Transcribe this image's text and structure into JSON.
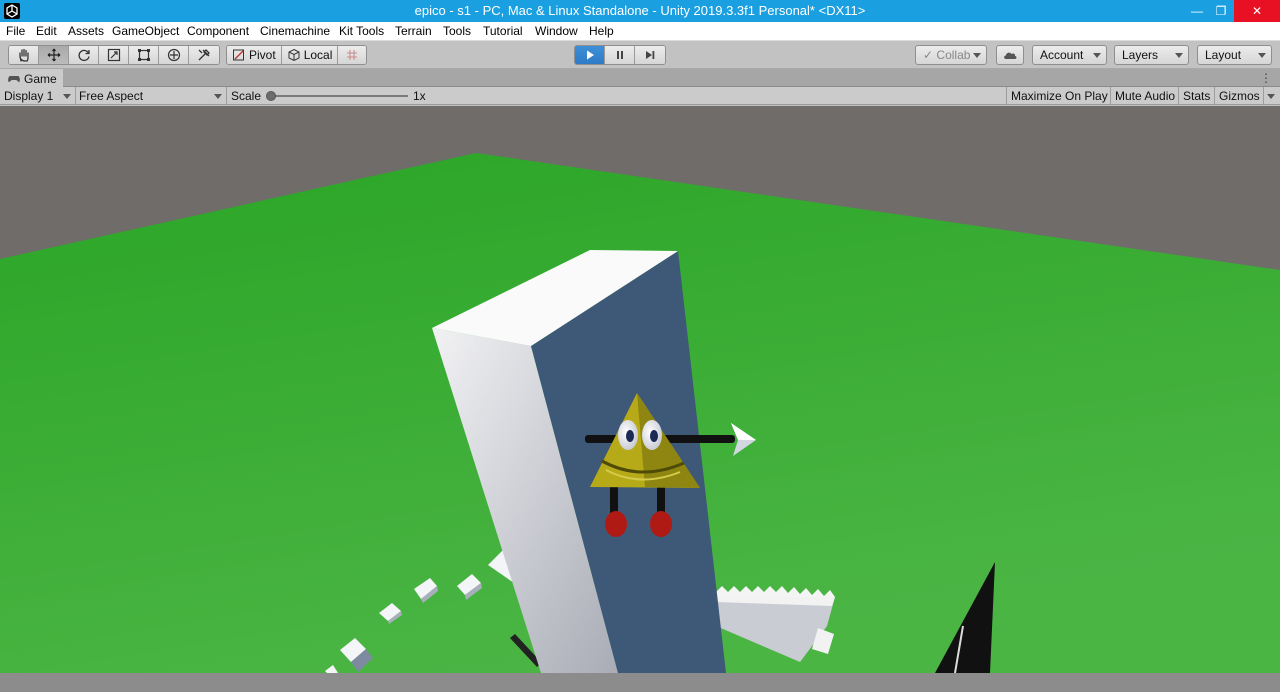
{
  "window": {
    "title": "epico - s1 - PC, Mac & Linux Standalone - Unity 2019.3.3f1 Personal* <DX11>"
  },
  "menu": [
    "File",
    "Edit",
    "Assets",
    "GameObject",
    "Component",
    "Cinemachine",
    "Kit Tools",
    "Terrain",
    "Tools",
    "Tutorial",
    "Window",
    "Help"
  ],
  "toolbar": {
    "pivot_label": "Pivot",
    "local_label": "Local",
    "collab_label": "Collab",
    "account_label": "Account",
    "layers_label": "Layers",
    "layout_label": "Layout",
    "tools": [
      "hand-icon",
      "move-icon",
      "rotate-icon",
      "scale-icon",
      "rect-transform-icon",
      "transform-icon",
      "custom-tool-icon"
    ],
    "playing": true
  },
  "game_tab": {
    "label": "Game"
  },
  "game_view": {
    "display": "Display 1",
    "aspect": "Free Aspect",
    "scale_label": "Scale",
    "scale_value": "1x",
    "scale_fraction": 0.0,
    "maximize_on_play": "Maximize On Play",
    "mute_audio": "Mute Audio",
    "stats": "Stats",
    "gizmos": "Gizmos"
  },
  "colors": {
    "titlebar": "#1a9fe0",
    "play_active": "#3d8fd8",
    "ground": "#2aa526",
    "sky": "#6f6c69"
  }
}
